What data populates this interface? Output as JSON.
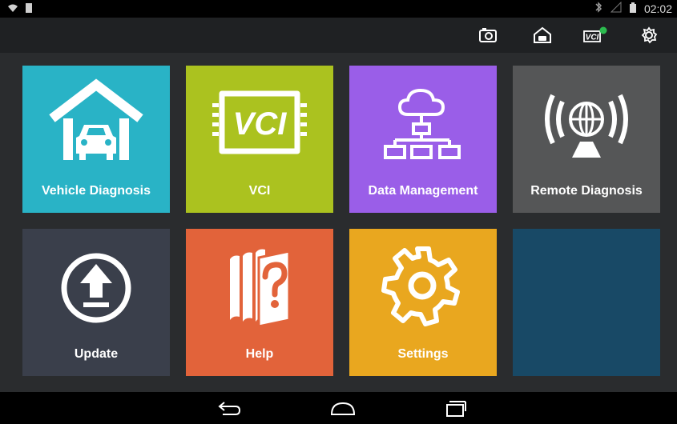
{
  "status_bar": {
    "time": "02:02",
    "icons": [
      "wifi-icon",
      "sim-icon",
      "bluetooth-icon",
      "signal-icon",
      "battery-icon"
    ]
  },
  "toolbar": {
    "icons": [
      "camera-icon",
      "garage-icon",
      "vci-icon",
      "settings-gear-icon"
    ],
    "vci_label": "VCI"
  },
  "tiles": [
    {
      "label": "Vehicle Diagnosis",
      "color": "#29b3c6",
      "icon": "garage-car-icon"
    },
    {
      "label": "VCI",
      "color": "#abc21f",
      "icon": "vci-chip-icon"
    },
    {
      "label": "Data Management",
      "color": "#9a5ee8",
      "icon": "cloud-network-icon"
    },
    {
      "label": "Remote Diagnosis",
      "color": "#555657",
      "icon": "broadcast-globe-icon"
    },
    {
      "label": "Update",
      "color": "#3a3f4b",
      "icon": "upload-arrow-icon"
    },
    {
      "label": "Help",
      "color": "#e2633a",
      "icon": "help-books-icon"
    },
    {
      "label": "Settings",
      "color": "#e9a71f",
      "icon": "gear-icon"
    },
    {
      "label": "",
      "color": "#184966",
      "icon": ""
    }
  ],
  "nav": {
    "buttons": [
      "back-icon",
      "home-icon",
      "recents-icon"
    ]
  }
}
